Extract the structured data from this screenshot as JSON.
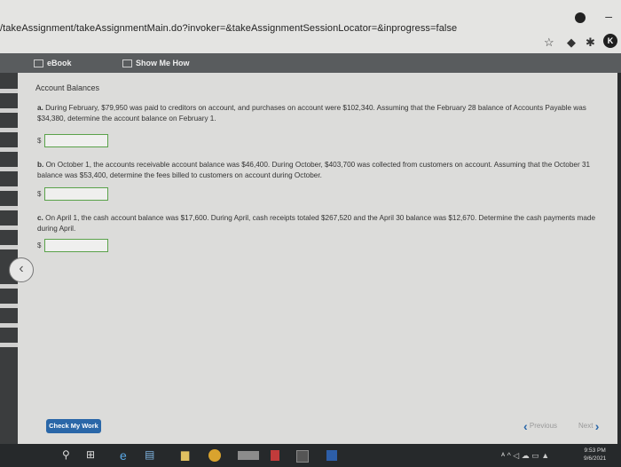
{
  "browser": {
    "url": "/takeAssignment/takeAssignmentMain.do?invoker=&takeAssignmentSessionLocator=&inprogress=false"
  },
  "toolbar": {
    "ebook_label": "eBook",
    "show_me_how_label": "Show Me How"
  },
  "content": {
    "title": "Account Balances",
    "questions": [
      {
        "letter": "a.",
        "text": "During February, $79,950 was paid to creditors on account, and purchases on account were $102,340. Assuming that the February 28 balance of Accounts Payable was $34,380, determine the account balance on February 1.",
        "currency": "$",
        "answer": ""
      },
      {
        "letter": "b.",
        "text": "On October 1, the accounts receivable account balance was $46,400. During October, $403,700 was collected from customers on account. Assuming that the October 31 balance was $53,400, determine the fees billed to customers on account during October.",
        "currency": "$",
        "answer": ""
      },
      {
        "letter": "c.",
        "text": "On April 1, the cash account balance was $17,600. During April, cash receipts totaled $267,520 and the April 30 balance was $12,670. Determine the cash payments made during April.",
        "currency": "$",
        "answer": ""
      }
    ],
    "check_button": "Check My Work",
    "previous_label": "Previous",
    "next_label": "Next"
  },
  "taskbar": {
    "time": "9:53 PM",
    "date": "9/6/2021"
  }
}
